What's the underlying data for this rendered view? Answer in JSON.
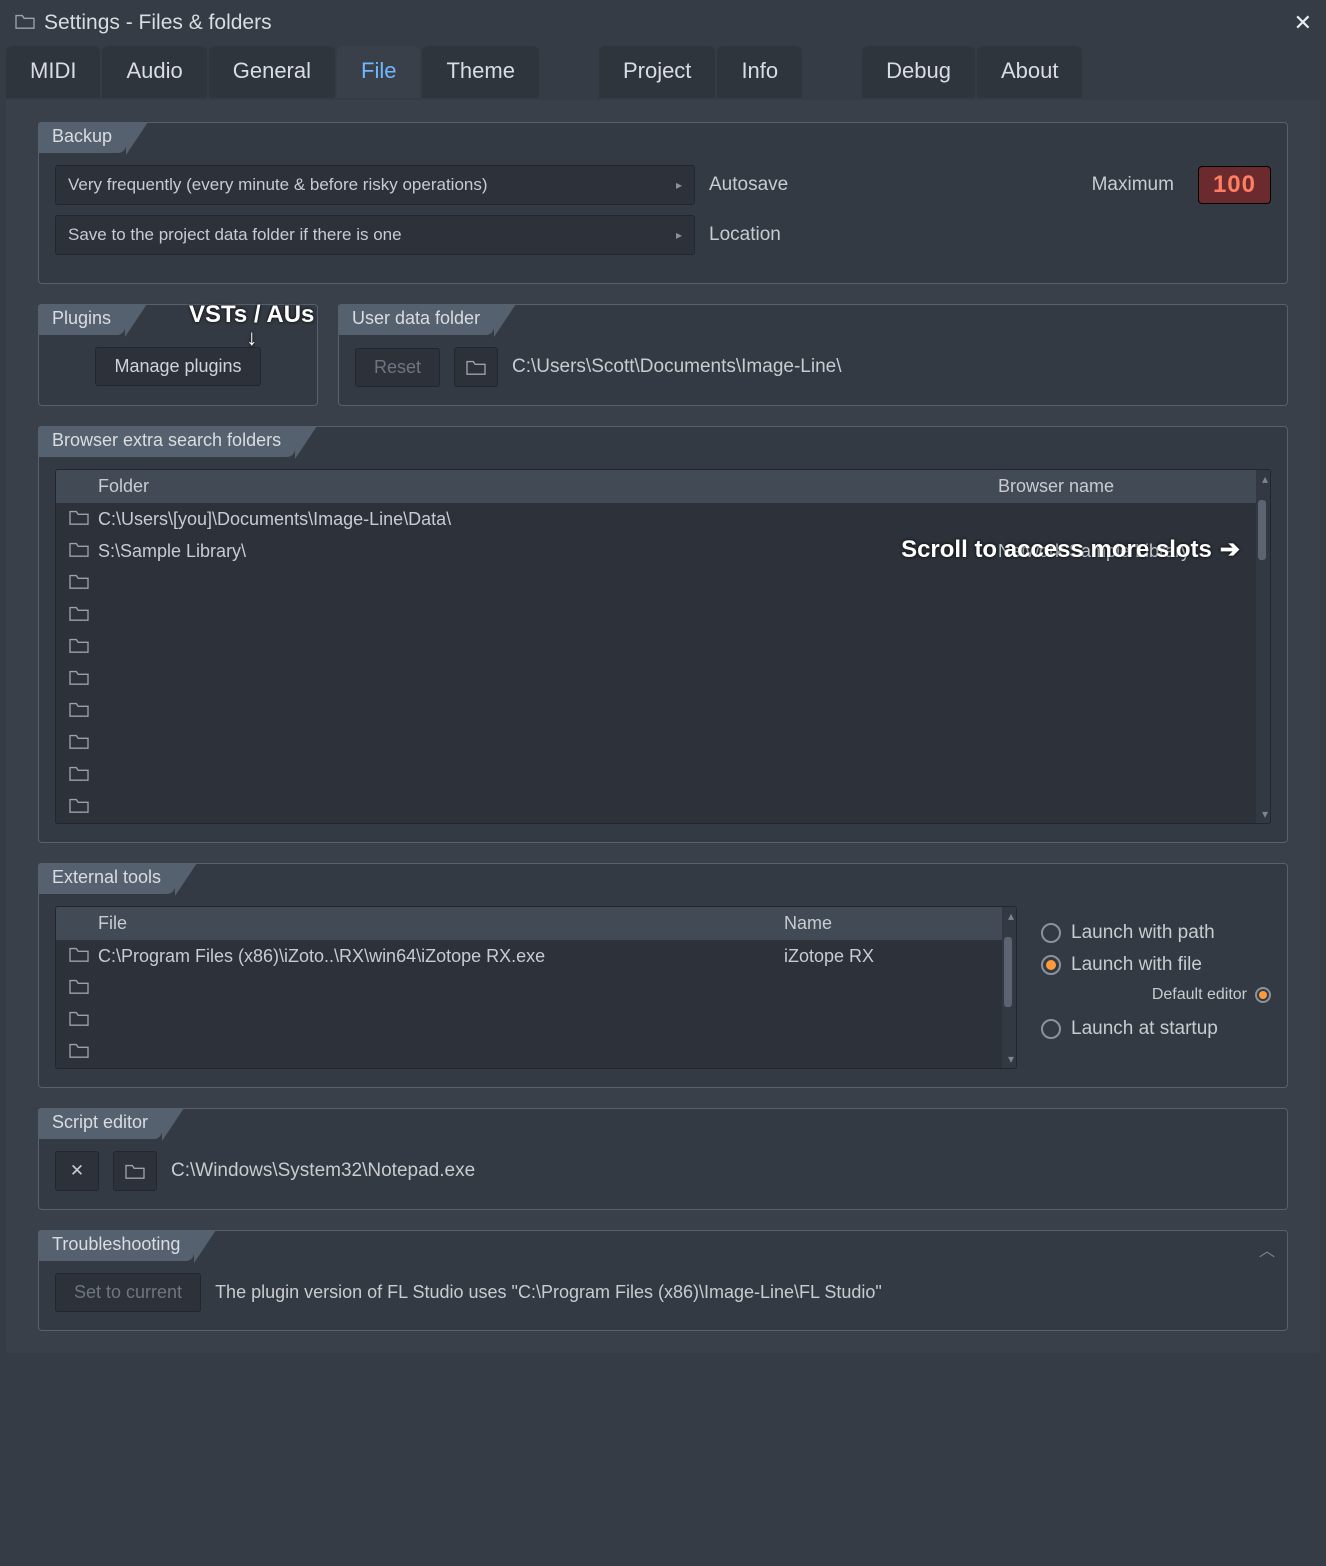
{
  "window": {
    "title": "Settings - Files & folders"
  },
  "tabs": [
    "MIDI",
    "Audio",
    "General",
    "File",
    "Theme",
    "Project",
    "Info",
    "Debug",
    "About"
  ],
  "active_tab": "File",
  "backup": {
    "title": "Backup",
    "autosave_value": "Very frequently (every minute & before risky operations)",
    "autosave_label": "Autosave",
    "location_value": "Save to the project data folder if there is one",
    "location_label": "Location",
    "max_label": "Maximum",
    "max_value": "100"
  },
  "plugins": {
    "title": "Plugins",
    "annotation": "VSTs / AUs",
    "manage_btn": "Manage plugins"
  },
  "userdata": {
    "title": "User data folder",
    "reset_btn": "Reset",
    "path": "C:\\Users\\Scott\\Documents\\Image-Line\\"
  },
  "browserfolders": {
    "title": "Browser extra search folders",
    "col_folder": "Folder",
    "col_name": "Browser name",
    "annotation": "Scroll to access more slots",
    "rows": [
      {
        "folder": "C:\\Users\\[you]\\Documents\\Image-Line\\Data\\",
        "name": ""
      },
      {
        "folder": "S:\\Sample Library\\",
        "name": "Network Sample Library"
      },
      {
        "folder": "",
        "name": ""
      },
      {
        "folder": "",
        "name": ""
      },
      {
        "folder": "",
        "name": ""
      },
      {
        "folder": "",
        "name": ""
      },
      {
        "folder": "",
        "name": ""
      },
      {
        "folder": "",
        "name": ""
      },
      {
        "folder": "",
        "name": ""
      },
      {
        "folder": "",
        "name": ""
      }
    ]
  },
  "externaltools": {
    "title": "External tools",
    "col_file": "File",
    "col_name": "Name",
    "rows": [
      {
        "file": "C:\\Program Files (x86)\\iZoto..\\RX\\win64\\iZotope RX.exe",
        "name": "iZotope RX"
      },
      {
        "file": "",
        "name": ""
      },
      {
        "file": "",
        "name": ""
      },
      {
        "file": "",
        "name": ""
      }
    ],
    "radios": {
      "path": "Launch with path",
      "file": "Launch with file",
      "default_editor": "Default editor",
      "startup": "Launch at startup"
    },
    "selected_radio": "file",
    "default_editor_selected": true
  },
  "scripteditor": {
    "title": "Script editor",
    "path": "C:\\Windows\\System32\\Notepad.exe"
  },
  "troubleshooting": {
    "title": "Troubleshooting",
    "set_btn": "Set to current",
    "info": "The plugin version of FL Studio uses \"C:\\Program Files (x86)\\Image-Line\\FL Studio\""
  }
}
